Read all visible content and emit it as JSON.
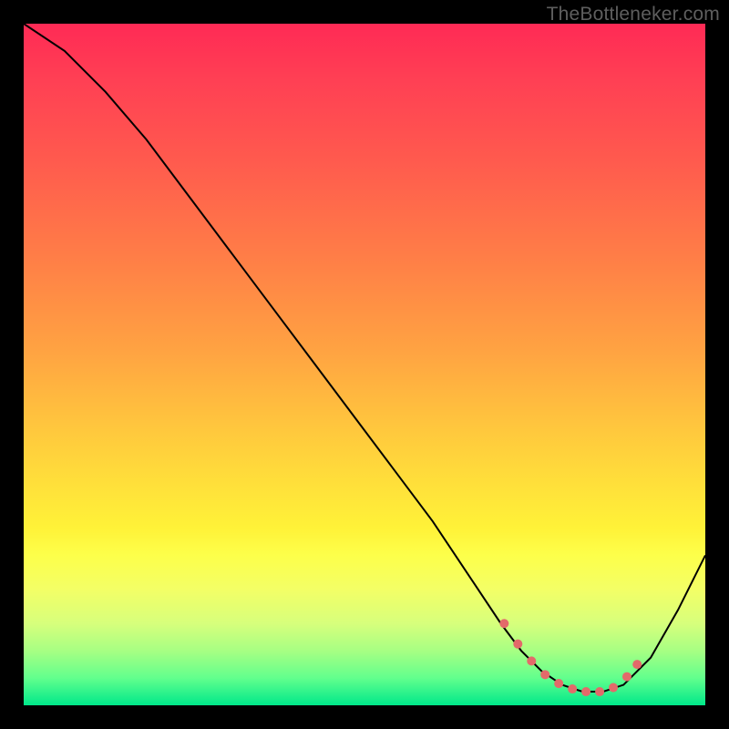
{
  "watermark": "TheBottleneker.com",
  "chart_data": {
    "type": "line",
    "title": "",
    "xlabel": "",
    "ylabel": "",
    "xlim": [
      0,
      100
    ],
    "ylim": [
      0,
      100
    ],
    "grid": false,
    "legend": false,
    "series": [
      {
        "name": "bottleneck-curve",
        "color": "#000000",
        "stroke_width": 2,
        "x": [
          0,
          6,
          12,
          18,
          24,
          30,
          36,
          42,
          48,
          54,
          60,
          66,
          70,
          73,
          76,
          79,
          82,
          85,
          88,
          92,
          96,
          100
        ],
        "y": [
          100,
          96,
          90,
          83,
          75,
          67,
          59,
          51,
          43,
          35,
          27,
          18,
          12,
          8,
          5,
          3,
          2,
          2,
          3,
          7,
          14,
          22
        ]
      },
      {
        "name": "optimal-range-dots",
        "color": "#e36a6a",
        "type": "scatter",
        "marker_radius": 5,
        "x": [
          70.5,
          72.5,
          74.5,
          76.5,
          78.5,
          80.5,
          82.5,
          84.5,
          86.5,
          88.5,
          90.0
        ],
        "y": [
          12.0,
          9.0,
          6.5,
          4.5,
          3.2,
          2.4,
          2.0,
          2.0,
          2.6,
          4.2,
          6.0
        ]
      }
    ],
    "background_gradient_stops": [
      {
        "pos": 0,
        "color": "#ff2a55"
      },
      {
        "pos": 8,
        "color": "#ff3f54"
      },
      {
        "pos": 20,
        "color": "#ff5a4e"
      },
      {
        "pos": 34,
        "color": "#ff7d47"
      },
      {
        "pos": 48,
        "color": "#ffa342"
      },
      {
        "pos": 60,
        "color": "#ffc93d"
      },
      {
        "pos": 68,
        "color": "#ffe13a"
      },
      {
        "pos": 74,
        "color": "#fff238"
      },
      {
        "pos": 78,
        "color": "#fdff4a"
      },
      {
        "pos": 83,
        "color": "#f3ff66"
      },
      {
        "pos": 88,
        "color": "#d7ff7c"
      },
      {
        "pos": 92,
        "color": "#a7ff83"
      },
      {
        "pos": 96,
        "color": "#62ff8d"
      },
      {
        "pos": 100,
        "color": "#00e88a"
      }
    ]
  }
}
